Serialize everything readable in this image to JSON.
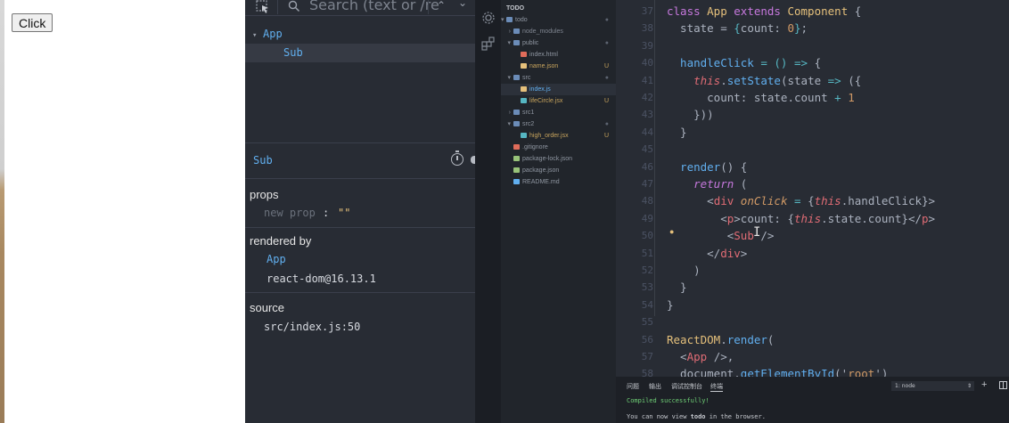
{
  "app": {
    "button_label": "Click"
  },
  "devtools": {
    "search_placeholder": "Search (text or /re",
    "tree": [
      {
        "toggle": "▾",
        "label": "App"
      },
      {
        "toggle": "",
        "label": "Sub"
      }
    ],
    "selected_component": "Sub",
    "props_heading": "props",
    "new_prop_placeholder": "new prop",
    "new_prop_colon": ":",
    "new_prop_value": "\"\"",
    "rendered_by_heading": "rendered by",
    "rendered_by": [
      "App",
      "react-dom@16.13.1"
    ],
    "source_heading": "source",
    "source_value": "src/index.js:50"
  },
  "vscode": {
    "explorer": {
      "title": "TODO",
      "rows": [
        {
          "label": "todo",
          "indent": 1,
          "chev": "▾",
          "icon": "folder-icon",
          "color": "#8f96a1",
          "badge": "●"
        },
        {
          "label": "node_modules",
          "indent": 2,
          "chev": "›",
          "icon": "folder-icon",
          "color": "#7f8590",
          "badge": ""
        },
        {
          "label": "public",
          "indent": 2,
          "chev": "▾",
          "icon": "folder-icon",
          "color": "#8f96a1",
          "badge": "●"
        },
        {
          "label": "index.html",
          "indent": 3,
          "chev": "",
          "icon": "html-file-icon",
          "color": "#8f96a1",
          "badge": ""
        },
        {
          "label": "name.json",
          "indent": 3,
          "chev": "",
          "icon": "json-file-icon",
          "color": "#c8a45d",
          "badge": "U"
        },
        {
          "label": "src",
          "indent": 2,
          "chev": "▾",
          "icon": "folder-icon",
          "color": "#8f96a1",
          "badge": "●"
        },
        {
          "label": "index.js",
          "indent": 3,
          "chev": "",
          "icon": "js-file-icon",
          "color": "#61afef",
          "badge": ""
        },
        {
          "label": "lifeCircle.jsx",
          "indent": 3,
          "chev": "",
          "icon": "react-file-icon",
          "color": "#c8a45d",
          "badge": "U"
        },
        {
          "label": "src1",
          "indent": 2,
          "chev": "›",
          "icon": "folder-icon",
          "color": "#8f96a1",
          "badge": ""
        },
        {
          "label": "src2",
          "indent": 2,
          "chev": "▾",
          "icon": "folder-icon",
          "color": "#8f96a1",
          "badge": "●"
        },
        {
          "label": "high_order.jsx",
          "indent": 3,
          "chev": "",
          "icon": "react-file-icon",
          "color": "#c8a45d",
          "badge": "U"
        },
        {
          "label": ".gitignore",
          "indent": 2,
          "chev": "",
          "icon": "git-file-icon",
          "color": "#8f96a1",
          "badge": ""
        },
        {
          "label": "package-lock.json",
          "indent": 2,
          "chev": "",
          "icon": "npm-file-icon",
          "color": "#8f96a1",
          "badge": ""
        },
        {
          "label": "package.json",
          "indent": 2,
          "chev": "",
          "icon": "npm-file-icon",
          "color": "#8f96a1",
          "badge": ""
        },
        {
          "label": "README.md",
          "indent": 2,
          "chev": "",
          "icon": "info-file-icon",
          "color": "#8f96a1",
          "badge": ""
        }
      ]
    },
    "editor": {
      "line_numbers": [
        "37",
        "38",
        "39",
        "40",
        "41",
        "42",
        "43",
        "44",
        "45",
        "46",
        "47",
        "48",
        "49",
        "50",
        "51",
        "52",
        "53",
        "54",
        "55",
        "56",
        "57",
        "58"
      ],
      "code_lines": [
        [
          [
            "k",
            "class "
          ],
          [
            "c",
            "App "
          ],
          [
            "k",
            "extends "
          ],
          [
            "c",
            "Component "
          ],
          [
            "p",
            "{"
          ]
        ],
        [
          [
            "p",
            "  state = "
          ],
          [
            "b",
            "{"
          ],
          [
            "p",
            "count: "
          ],
          [
            "n",
            "0"
          ],
          [
            "b",
            "}"
          ],
          [
            "p",
            ";"
          ]
        ],
        [],
        [
          [
            "f",
            "  handleClick "
          ],
          [
            "b",
            "= () => "
          ],
          [
            "p",
            "{"
          ]
        ],
        [
          [
            "p",
            "    "
          ],
          [
            "it",
            "this"
          ],
          [
            "p",
            "."
          ],
          [
            "f",
            "setState"
          ],
          [
            "p",
            "(state "
          ],
          [
            "b",
            "=> "
          ],
          [
            "p",
            "({"
          ]
        ],
        [
          [
            "p",
            "      count: state.count "
          ],
          [
            "b",
            "+ "
          ],
          [
            "n",
            "1"
          ]
        ],
        [
          [
            "p",
            "    }))"
          ]
        ],
        [
          [
            "p",
            "  }"
          ]
        ],
        [],
        [
          [
            "f",
            "  render"
          ],
          [
            "p",
            "() {"
          ]
        ],
        [
          [
            "kw",
            "    return "
          ],
          [
            "p",
            "("
          ]
        ],
        [
          [
            "p",
            "      <"
          ],
          [
            "t",
            "div "
          ],
          [
            "a",
            "onClick "
          ],
          [
            "b",
            "= "
          ],
          [
            "p",
            "{"
          ],
          [
            "it",
            "this"
          ],
          [
            "p",
            ".handleClick}>"
          ]
        ],
        [
          [
            "p",
            "        <"
          ],
          [
            "t",
            "p"
          ],
          [
            "p",
            ">count: {"
          ],
          [
            "it",
            "this"
          ],
          [
            "p",
            ".state.count}</"
          ],
          [
            "t",
            "p"
          ],
          [
            "p",
            ">"
          ]
        ],
        [
          [
            "p",
            "         <"
          ],
          [
            "t",
            "Sub "
          ],
          [
            "p",
            "/>"
          ]
        ],
        [
          [
            "p",
            "      </"
          ],
          [
            "t",
            "div"
          ],
          [
            "p",
            ">"
          ]
        ],
        [
          [
            "p",
            "    )"
          ]
        ],
        [
          [
            "p",
            "  }"
          ]
        ],
        [
          [
            "p",
            "}"
          ]
        ],
        [],
        [
          [
            "c",
            "ReactDOM"
          ],
          [
            "p",
            "."
          ],
          [
            "f",
            "render"
          ],
          [
            "p",
            "("
          ]
        ],
        [
          [
            "p",
            "  <"
          ],
          [
            "t",
            "App "
          ],
          [
            "p",
            "/>,"
          ]
        ],
        [
          [
            "p",
            "  document."
          ],
          [
            "f",
            "getElementById"
          ],
          [
            "p",
            "('"
          ],
          [
            "n",
            "root"
          ],
          [
            "p",
            "')"
          ]
        ]
      ]
    },
    "terminal": {
      "tabs": [
        "问题",
        "输出",
        "调试控制台",
        "终端"
      ],
      "shell_select": "1: node",
      "compiled": "Compiled successfully!",
      "view_prefix": "You can now view ",
      "view_app": "todo",
      "view_suffix": " in the browser."
    }
  }
}
